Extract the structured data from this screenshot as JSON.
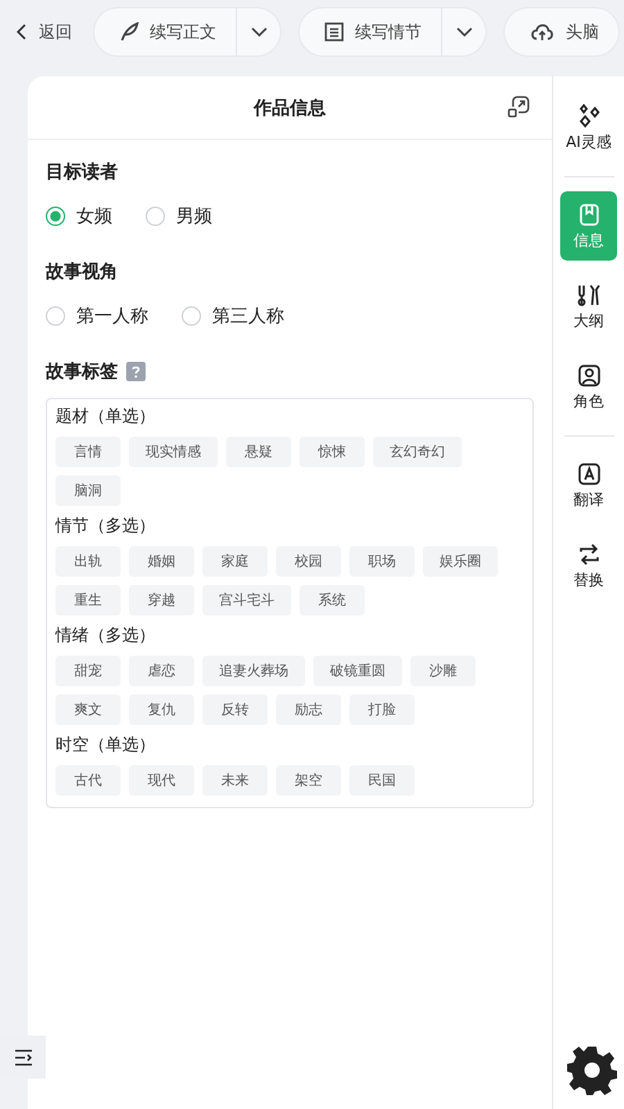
{
  "toolbar": {
    "back": "返回",
    "buttons": [
      {
        "label": "续写正文",
        "dropdown": true
      },
      {
        "label": "续写情节",
        "dropdown": true
      },
      {
        "label": "头脑",
        "dropdown": false
      }
    ]
  },
  "panel": {
    "title": "作品信息",
    "sections": [
      {
        "kind": "radio",
        "title": "目标读者",
        "options": [
          {
            "label": "女频",
            "selected": true
          },
          {
            "label": "男频",
            "selected": false
          }
        ]
      },
      {
        "kind": "radio",
        "title": "故事视角",
        "options": [
          {
            "label": "第一人称",
            "selected": false
          },
          {
            "label": "第三人称",
            "selected": false
          }
        ]
      },
      {
        "kind": "tags",
        "title": "故事标签",
        "help": true,
        "groups": [
          {
            "title": "题材（单选）",
            "tags": [
              {
                "label": "言情",
                "selected": false
              },
              {
                "label": "现实情感",
                "selected": false
              },
              {
                "label": "悬疑",
                "selected": false
              },
              {
                "label": "惊悚",
                "selected": false
              },
              {
                "label": "玄幻奇幻",
                "selected": false
              },
              {
                "label": "脑洞",
                "selected": false
              }
            ]
          },
          {
            "title": "情节（多选）",
            "tags": [
              {
                "label": "出轨",
                "selected": false
              },
              {
                "label": "婚姻",
                "selected": false
              },
              {
                "label": "家庭",
                "selected": false
              },
              {
                "label": "校园",
                "selected": false
              },
              {
                "label": "职场",
                "selected": false
              },
              {
                "label": "娱乐圈",
                "selected": false
              },
              {
                "label": "重生",
                "selected": false
              },
              {
                "label": "穿越",
                "selected": false
              },
              {
                "label": "宫斗宅斗",
                "selected": false
              },
              {
                "label": "系统",
                "selected": false
              }
            ]
          },
          {
            "title": "情绪（多选）",
            "tags": [
              {
                "label": "甜宠",
                "selected": false
              },
              {
                "label": "虐恋",
                "selected": false
              },
              {
                "label": "追妻火葬场",
                "selected": false
              },
              {
                "label": "破镜重圆",
                "selected": false
              },
              {
                "label": "沙雕",
                "selected": false
              },
              {
                "label": "爽文",
                "selected": false
              },
              {
                "label": "复仇",
                "selected": false
              },
              {
                "label": "反转",
                "selected": false
              },
              {
                "label": "励志",
                "selected": false
              },
              {
                "label": "打脸",
                "selected": false
              }
            ]
          },
          {
            "title": "时空（单选）",
            "tags": [
              {
                "label": "古代",
                "selected": false
              },
              {
                "label": "现代",
                "selected": false
              },
              {
                "label": "未来",
                "selected": false
              },
              {
                "label": "架空",
                "selected": false
              },
              {
                "label": "民国",
                "selected": false
              }
            ]
          }
        ]
      }
    ]
  },
  "sidebar": {
    "items": [
      {
        "label": "AI灵感",
        "selected": false,
        "divider_after": true
      },
      {
        "label": "信息",
        "selected": true,
        "divider_after": false
      },
      {
        "label": "大纲",
        "selected": false,
        "divider_after": false
      },
      {
        "label": "角色",
        "selected": false,
        "divider_after": true
      },
      {
        "label": "翻译",
        "selected": false,
        "divider_after": false
      },
      {
        "label": "替换",
        "selected": false,
        "divider_after": false
      }
    ]
  }
}
